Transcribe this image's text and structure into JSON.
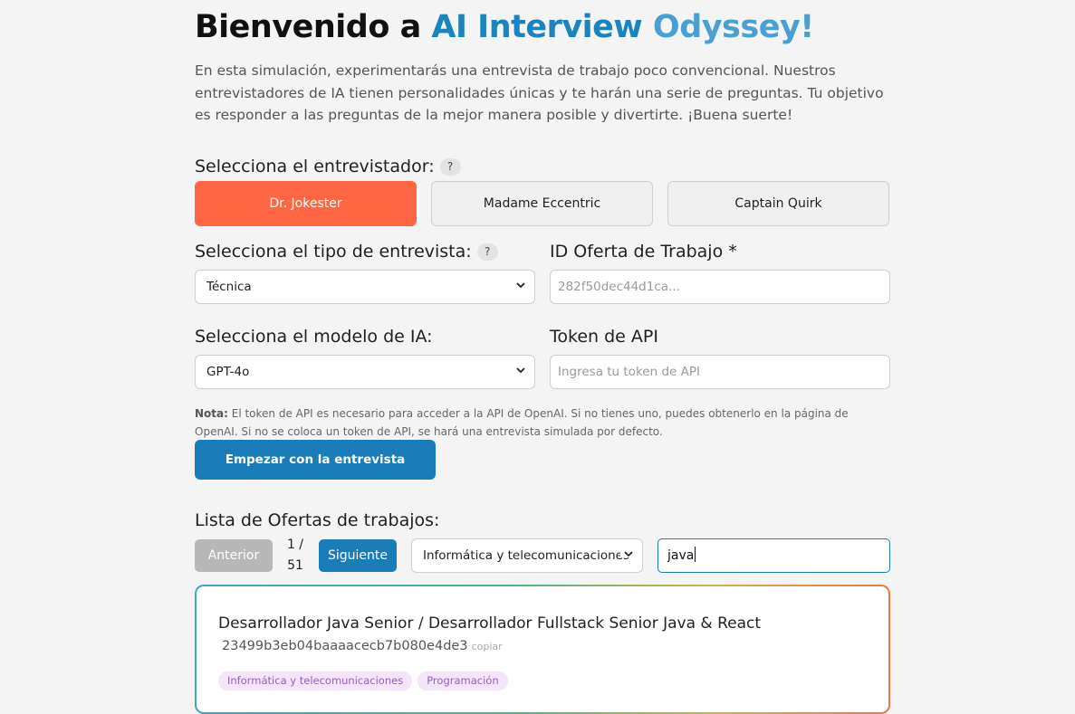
{
  "header": {
    "title_prefix": "Bienvenido a ",
    "title_brand_1": "AI Interview",
    "title_brand_2": " Odyssey",
    "title_suffix": "!",
    "intro": "En esta simulación, experimentarás una entrevista de trabajo poco convencional. Nuestros entrevistadores de IA tienen personalidades únicas y te harán una serie de preguntas. Tu objetivo es responder a las preguntas de la mejor manera posible y divertirte. ¡Buena suerte!"
  },
  "interviewer": {
    "label": "Selecciona el entrevistador:",
    "help": "?",
    "options": [
      {
        "label": "Dr. Jokester",
        "selected": true
      },
      {
        "label": "Madame Eccentric",
        "selected": false
      },
      {
        "label": "Captain Quirk",
        "selected": false
      }
    ]
  },
  "interview_type": {
    "label": "Selecciona el tipo de entrevista:",
    "help": "?",
    "value": "Técnica"
  },
  "job_offer_id": {
    "label": "ID Oferta de Trabajo *",
    "placeholder": "282f50dec44d1ca..."
  },
  "model": {
    "label": "Selecciona el modelo de IA:",
    "value": "GPT-4o"
  },
  "api_token": {
    "label": "Token de API",
    "placeholder": "Ingresa tu token de API"
  },
  "note": {
    "bold": "Nota:",
    "text": " El token de API es necesario para acceder a la API de OpenAI. Si no tienes uno, puedes obtenerlo en la página de OpenAI. Si no se coloca un token de API, se hará una entrevista simulada por defecto."
  },
  "start_button": "Empezar con la entrevista",
  "jobs": {
    "label": "Lista de Ofertas de trabajos:",
    "prev": "Anterior",
    "next": "Siguiente",
    "page_current": "1 /",
    "page_total": "51",
    "category": "Informática y telecomunicaciones",
    "search": "java",
    "items": [
      {
        "title": "Desarrollador Java Senior / Desarrollador Fullstack Senior Java & React",
        "id": "23499b3eb04baaaacecb7b080e4de3",
        "copy": "copiar",
        "tags": [
          "Informática y telecomunicaciones",
          "Programación"
        ]
      }
    ]
  },
  "colors": {
    "accent": "#1a7db9",
    "selected_interviewer": "#ff6644",
    "disabled": "#b8b8b8"
  }
}
